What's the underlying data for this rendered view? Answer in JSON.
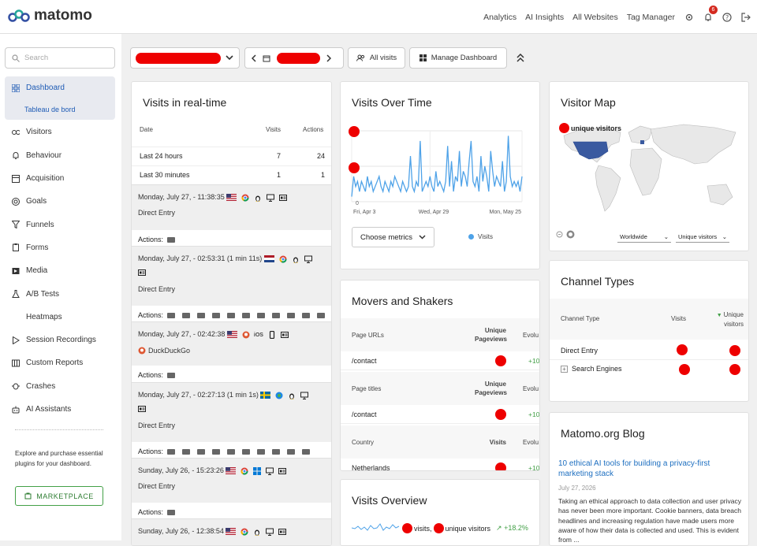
{
  "brand": {
    "name": "matomo"
  },
  "topnav": {
    "analytics": "Analytics",
    "ai_insights": "AI Insights",
    "all_websites": "All Websites",
    "tag_manager": "Tag Manager",
    "notif_count": "6"
  },
  "sidebar": {
    "search_placeholder": "Search",
    "items": [
      {
        "label": "Dashboard",
        "icon": "dashboard-icon"
      },
      {
        "label": "Visitors",
        "icon": "visitors-icon"
      },
      {
        "label": "Behaviour",
        "icon": "bell-icon"
      },
      {
        "label": "Acquisition",
        "icon": "acquisition-icon"
      },
      {
        "label": "Goals",
        "icon": "target-icon"
      },
      {
        "label": "Funnels",
        "icon": "funnel-icon"
      },
      {
        "label": "Forms",
        "icon": "clipboard-icon"
      },
      {
        "label": "Media",
        "icon": "media-icon"
      },
      {
        "label": "A/B Tests",
        "icon": "flask-icon"
      },
      {
        "label": "Heatmaps",
        "icon": "flame-icon"
      },
      {
        "label": "Session Recordings",
        "icon": "play-icon"
      },
      {
        "label": "Custom Reports",
        "icon": "reports-icon"
      },
      {
        "label": "Crashes",
        "icon": "bug-icon"
      },
      {
        "label": "AI Assistants",
        "icon": "robot-icon"
      }
    ],
    "sub_item": "Tableau de bord",
    "promo_text": "Explore and purchase essential plugins for your dashboard.",
    "marketplace": "MARKETPLACE"
  },
  "controls": {
    "all_visits": "All visits",
    "manage_dashboard": "Manage Dashboard"
  },
  "realtime": {
    "title": "Visits in real-time",
    "col_date": "Date",
    "col_visits": "Visits",
    "col_actions": "Actions",
    "rows": [
      {
        "label": "Last 24 hours",
        "visits": "7",
        "actions": "24"
      },
      {
        "label": "Last 30 minutes",
        "visits": "1",
        "actions": "1"
      }
    ],
    "visits": [
      {
        "time": "Monday, July 27, - 11:38:35",
        "referrer": "Direct Entry",
        "actions_label": "Actions:"
      },
      {
        "time": "Monday, July 27, - 02:53:31 (1 min 11s)",
        "referrer": "Direct Entry",
        "actions_label": "Actions:"
      },
      {
        "time": "Monday, July 27, - 02:42:38",
        "referrer": "DuckDuckGo",
        "os": "iOS",
        "actions_label": "Actions:"
      },
      {
        "time": "Monday, July 27, - 02:27:13 (1 min 1s)",
        "referrer": "Direct Entry",
        "actions_label": "Actions:"
      },
      {
        "time": "Sunday, July 26, - 15:23:26",
        "referrer": "Direct Entry",
        "actions_label": "Actions:"
      },
      {
        "time": "Sunday, July 26, - 12:38:54"
      }
    ]
  },
  "visits_over_time": {
    "title": "Visits Over Time",
    "choose_metrics": "Choose metrics",
    "legend": "Visits",
    "y_zero": "0",
    "chart_data": {
      "type": "line",
      "x_ticks": [
        "Fri, Apr 3",
        "Wed, Apr 29",
        "Mon, May 25"
      ],
      "series": [
        {
          "name": "Visits",
          "color": "#4ea2e8",
          "values": [
            1,
            5,
            3,
            4,
            2,
            4,
            3,
            2,
            5,
            3,
            4,
            2,
            3,
            4,
            5,
            3,
            2,
            4,
            3,
            2,
            4,
            3,
            5,
            4,
            3,
            2,
            4,
            3,
            2,
            3,
            9,
            3,
            2,
            4,
            3,
            12,
            2,
            3,
            4,
            3,
            5,
            3,
            2,
            6,
            3,
            4,
            3,
            2,
            4,
            11,
            3,
            8,
            2,
            5,
            4,
            10,
            3,
            6,
            5,
            3,
            8,
            12,
            4,
            3,
            5,
            2,
            9,
            4,
            7,
            5,
            2,
            10,
            6,
            3,
            5,
            4,
            3,
            8,
            2,
            4,
            13,
            5,
            3,
            4,
            3,
            4,
            2,
            5
          ]
        }
      ]
    }
  },
  "movers": {
    "title": "Movers and Shakers",
    "sections": [
      {
        "header": "Page URLs",
        "metric": "Unique Pageviews",
        "evolution": "Evolu",
        "row": "/contact",
        "change": "+10"
      },
      {
        "header": "Page titles",
        "metric": "Unique Pageviews",
        "evolution": "Evolu",
        "row": "/contact",
        "change": "+10"
      },
      {
        "header": "Country",
        "metric": "Visits",
        "evolution": "Evolu",
        "row": "Netherlands",
        "change": "+10"
      }
    ]
  },
  "visits_overview": {
    "title": "Visits Overview",
    "text_visits": "visits,",
    "text_unique": "unique visitors",
    "change": "+18.2%"
  },
  "visitor_map": {
    "title": "Visitor Map",
    "legend": "unique visitors",
    "region": "Worldwide",
    "metric": "Unique visitors"
  },
  "channel_types": {
    "title": "Channel Types",
    "col_type": "Channel Type",
    "col_visits": "Visits",
    "col_unique": "Unique visitors",
    "rows": [
      {
        "label": "Direct Entry"
      },
      {
        "label": "Search Engines"
      }
    ]
  },
  "blog": {
    "title": "Matomo.org Blog",
    "post_title": "10 ethical AI tools for building a privacy-first marketing stack",
    "date": "July 27, 2026",
    "excerpt": "Taking an ethical approach to data collection and user privacy has never been more important. Cookie banners, data breach headlines and increasing regulation have made users more aware of how their data is collected and used. This is evident from ..."
  }
}
